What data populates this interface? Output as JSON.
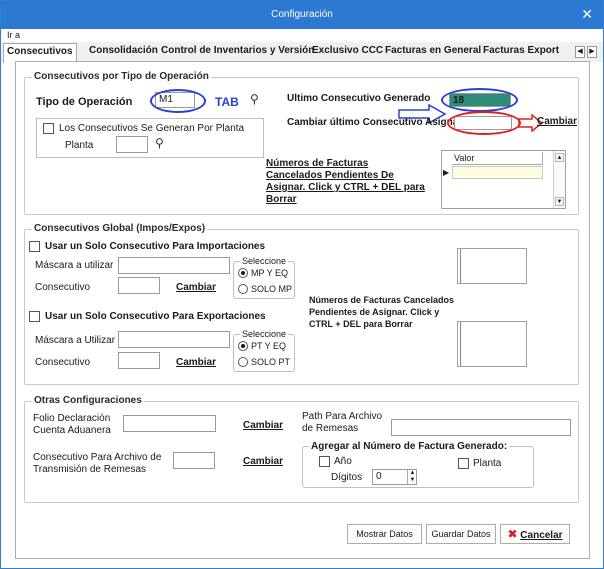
{
  "window": {
    "title": "Configuración",
    "close_glyph": "✕"
  },
  "menu": {
    "goto": "Ir a"
  },
  "tabs": [
    {
      "label": "Consecutivos"
    },
    {
      "label": "Consolidación"
    },
    {
      "label": "Control de Inventarios y Versión"
    },
    {
      "label": "Exclusivo CCC"
    },
    {
      "label": "Facturas en General"
    },
    {
      "label": "Facturas Exportac"
    }
  ],
  "tab_nav": {
    "prev": "◀",
    "next": "▶"
  },
  "consec_tipo": {
    "legend": "Consecutivos por Tipo de Operación",
    "tipo_label": "Tipo de Operación",
    "tipo_value": "M1",
    "tab_annotation": "TAB",
    "checkbox_label": "Los Consecutivos Se Generan Por Planta",
    "planta_label": "Planta",
    "planta_value": "",
    "ultimo_label": "Ultimo Consecutivo Generado",
    "ultimo_value": "18",
    "cambiar_ultimo_label": "Cambiar último Consecutivo Asignado",
    "cambiar_ultimo_value": "",
    "cambiar_link": "Cambiar",
    "facturas_canceladas_label": "Números de Facturas Cancelados Pendientes De Asignar. Click y CTRL + DEL para Borrar",
    "grid_header": "Valor",
    "grid_row_marker": "▶"
  },
  "consec_global": {
    "legend": "Consecutivos Global (Impos/Expos)",
    "import_checkbox": "Usar un Solo Consecutivo Para Importaciones",
    "import_mask_label": "Máscara a utilizar",
    "import_mask_value": "",
    "import_consec_label": "Consecutivo",
    "import_consec_value": "",
    "import_cambiar": "Cambiar",
    "import_select_legend": "Seleccione",
    "import_opt1": "MP Y EQ",
    "import_opt2": "SOLO MP",
    "export_checkbox": "Usar un Solo Consecutivo Para Exportaciones",
    "export_mask_label": "Máscara a Utilizar",
    "export_mask_value": "",
    "export_consec_label": "Consecutivo",
    "export_consec_value": "",
    "export_cambiar": "Cambiar",
    "export_select_legend": "Seleccione",
    "export_opt1": "PT Y EQ",
    "export_opt2": "SOLO PT",
    "facturas_canceladas_label": "Números de Facturas Cancelados Pendientes de Asignar. Click y CTRL + DEL para Borrar"
  },
  "otras": {
    "legend": "Otras Configuraciones",
    "folio_label": "Folio Declaración Cuenta Aduanera",
    "folio_value": "",
    "folio_cambiar": "Cambiar",
    "consec_remesas_label": "Consecutivo Para Archivo de Transmisión  de Remesas",
    "consec_remesas_value": "",
    "consec_remesas_cambiar": "Cambiar",
    "path_label": "Path Para Archivo de Remesas",
    "path_value": "",
    "agregar_legend": "Agregar al Número de Factura Generado:",
    "anio_label": "Año",
    "planta_label": "Planta",
    "digitos_label": "Dígitos",
    "digitos_value": "0"
  },
  "buttons": {
    "mostrar": "Mostrar Datos",
    "guardar": "Guardar Datos",
    "cancelar": "Cancelar",
    "cancel_glyph": "✖"
  },
  "colors": {
    "titlebar": "#2b79d3",
    "annotation_blue": "#2a3fd6",
    "annotation_red": "#e02020",
    "ultimo_field_bg": "#2e8b7a",
    "grid_selected_row": "#fffde0"
  }
}
